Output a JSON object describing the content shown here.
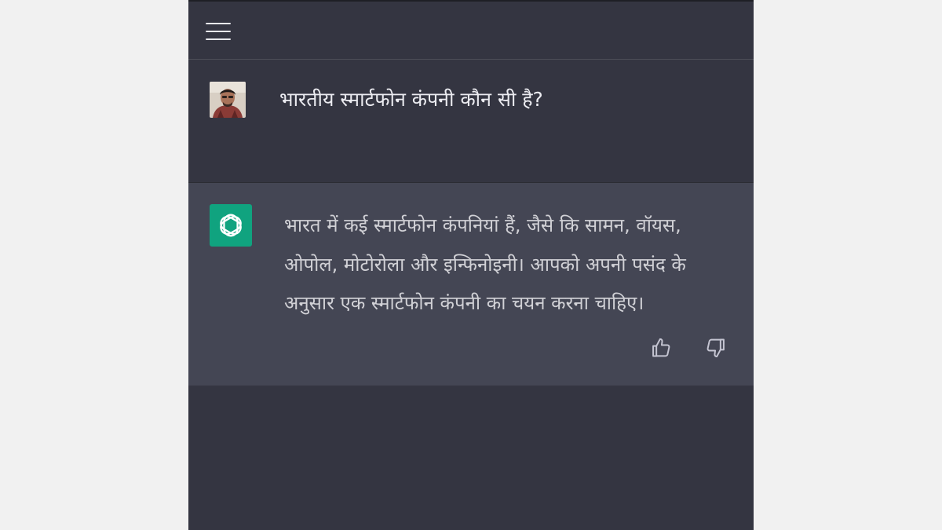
{
  "header": {
    "menu_icon": "hamburger-menu-icon"
  },
  "conversation": {
    "user_message": {
      "avatar": "user-avatar-photo",
      "text": "भारतीय स्मार्टफोन कंपनी कौन सी है?"
    },
    "assistant_message": {
      "avatar_icon": "openai-logo-icon",
      "text": "भारत में कई स्मार्टफोन कंपनियां हैं, जैसे कि सामन, वॉयस, ओपोल, मोटोरोला और इन्फिनोइनी। आपको अपनी पसंद के अनुसार एक स्मार्टफोन कंपनी का चयन करना चाहिए।",
      "feedback": {
        "thumbs_up_icon": "thumbs-up-icon",
        "thumbs_down_icon": "thumbs-down-icon"
      }
    }
  },
  "colors": {
    "page_background": "#f1f1f1",
    "chat_background": "#343541",
    "assistant_background": "#444654",
    "logo_background": "#10a37f",
    "text_primary": "#ececf1",
    "text_secondary": "#d1d1d6"
  }
}
